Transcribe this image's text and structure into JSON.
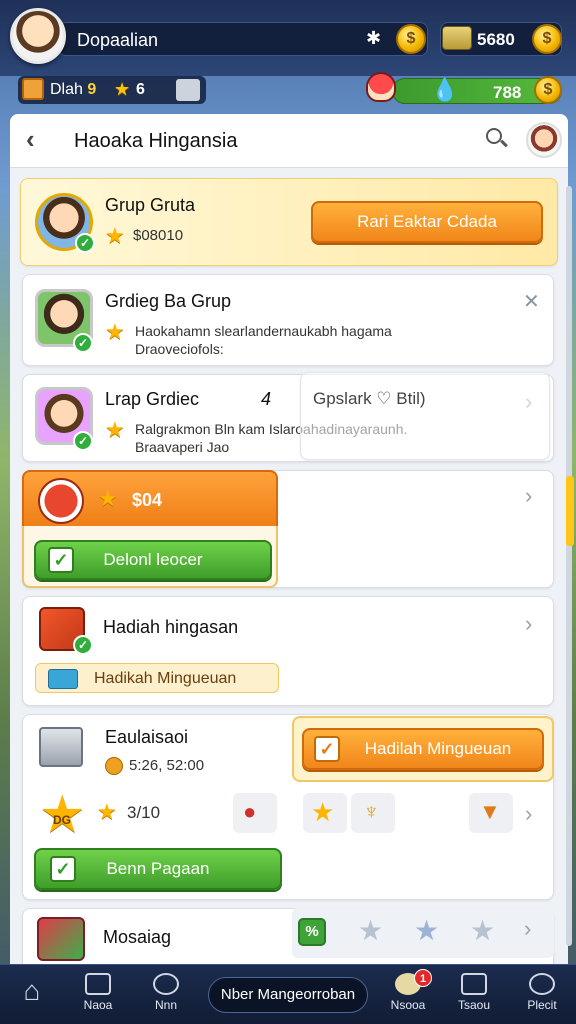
{
  "topbar": {
    "username": "Dopaalian",
    "cash": "5680",
    "sub_label": "Dlah",
    "sub_level": "9",
    "sub_stars": "6",
    "water": "788"
  },
  "header": {
    "title": "Haoaka Hingansia"
  },
  "group_card": {
    "title": "Grup Gruta",
    "amount": "$08010",
    "button": "Rari Eaktar Cdada"
  },
  "group_invite": {
    "title": "Grdieg Ba Grup",
    "desc_line1": "Haokahamn slearlandernaukabh hagama",
    "desc_line2": "Draoveciofols:"
  },
  "leap_card": {
    "title": "Lrap Grdiec",
    "rank": "4",
    "right_label": "Gpslark ♡ Btil)",
    "desc_line1": "Ralgrakmon Bln kam Islaroahadinayaraunh.",
    "desc_line2": "Braavaperi Jao"
  },
  "reward_card": {
    "amount": "$04",
    "button": "Delonl leocer"
  },
  "gift_card": {
    "title": "Hadiah hingasan",
    "button": "Hadikah Mingueuan"
  },
  "evaluation_card": {
    "title": "Eaulaisaoi",
    "time": "5:26, 52:00",
    "button": "Hadilah Mingueuan",
    "medal_label": "DG",
    "score": "3/10",
    "claim_button": "Benn Pagaan"
  },
  "message_card": {
    "title": "Mosaiag",
    "check_label": "%"
  },
  "bottomnav": {
    "items": [
      "Naoa",
      "Nnn",
      "Nsooa",
      "Tsaou",
      "Plecit"
    ],
    "center_label": "Nber Mangeorroban",
    "badge": "1"
  },
  "colors": {
    "accent_orange": "#f1861b",
    "accent_green": "#3f9e2a",
    "star_gold": "#ffb400",
    "nav_bg": "#111c34"
  }
}
